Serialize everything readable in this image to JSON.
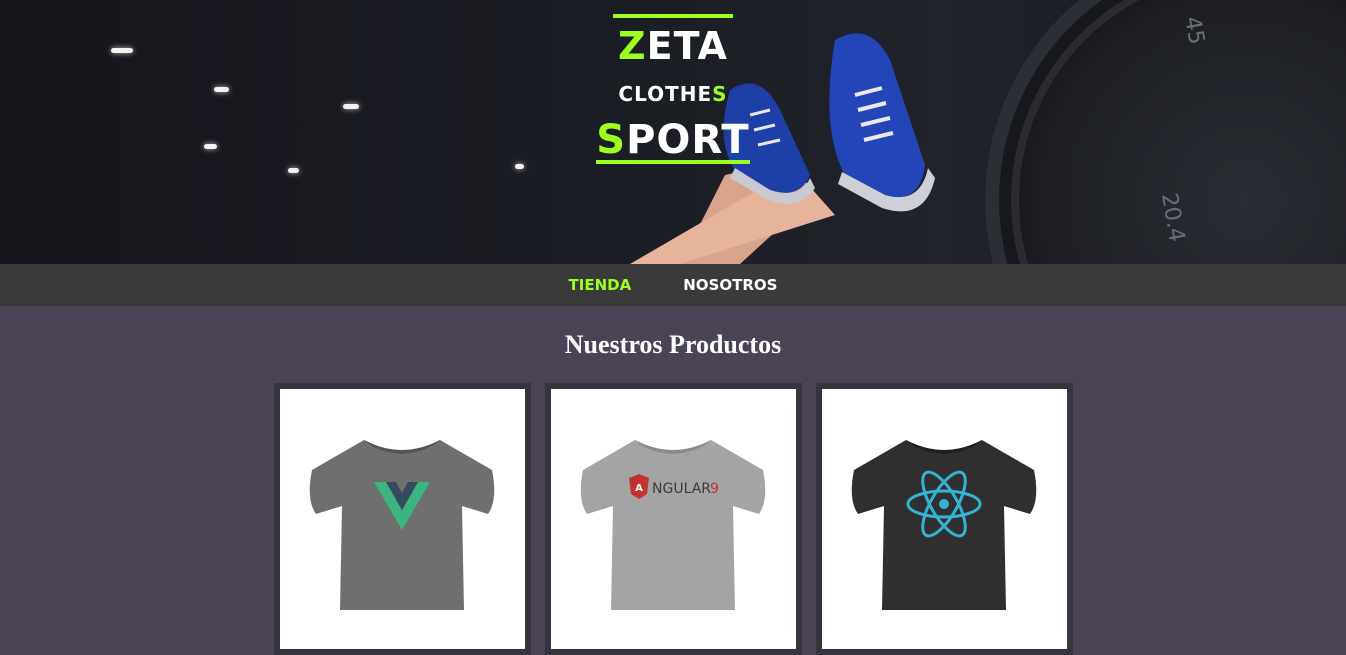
{
  "brand": {
    "word1_first": "Z",
    "word1_rest": "ETA",
    "word2_rest": "CLOTHE",
    "word2_last": "S",
    "word3_first": "S",
    "word3_rest": "PORT"
  },
  "hero": {
    "plate_numbers": [
      "45",
      "20.4"
    ]
  },
  "nav": {
    "items": [
      {
        "label": "TIENDA",
        "active": true
      },
      {
        "label": "NOSOTROS",
        "active": false
      }
    ]
  },
  "main": {
    "title": "Nuestros Productos"
  },
  "products": [
    {
      "shirt_color": "#6f6f6f",
      "logo": "vue-logo-icon"
    },
    {
      "shirt_color": "#a4a4a4",
      "logo": "angular-logo-icon",
      "logo_text_a": "A",
      "logo_text_rest": "NGULAR",
      "logo_text_num": "9"
    },
    {
      "shirt_color": "#2f2f2f",
      "logo": "react-logo-icon"
    }
  ],
  "colors": {
    "accent": "#9cff1f",
    "nav_bg": "#3a3a3a",
    "page_bg": "#4a4356",
    "card_border": "#38343f"
  }
}
